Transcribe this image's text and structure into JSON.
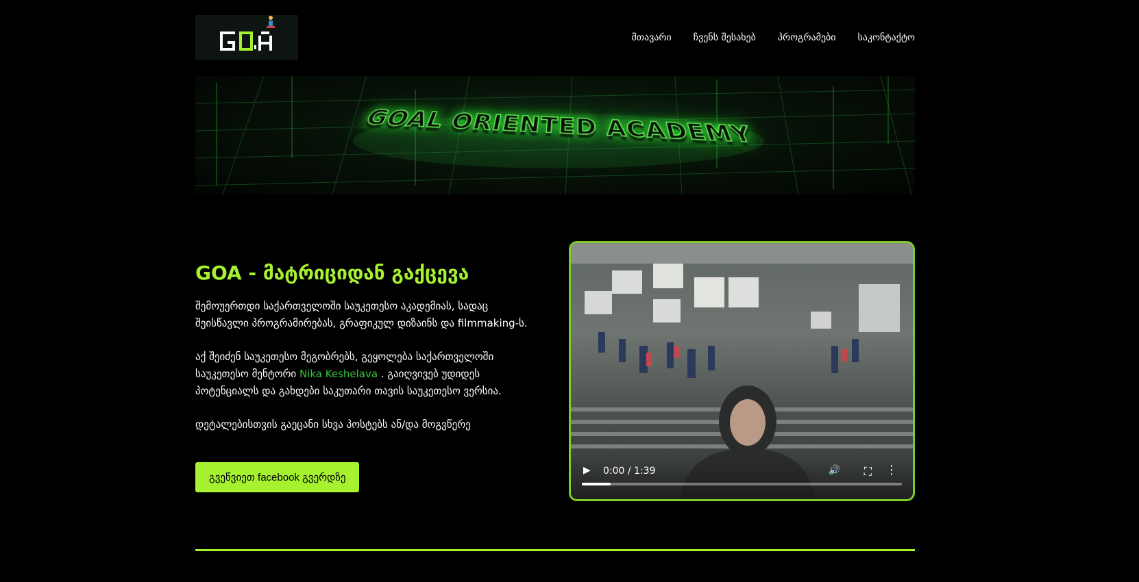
{
  "logo": {
    "text": "GOA"
  },
  "nav": {
    "items": [
      "მთავარი",
      "ჩვენს შესახებ",
      "პროგრამები",
      "საკონტაქტო"
    ]
  },
  "banner": {
    "text": "GOAL ORIENTED ACADEMY"
  },
  "hero": {
    "title": "GOA - მატრიციდან გაქცევა",
    "para1": "შემოუერთდი საქართველოში საუკეთესო აკადემიას, სადაც შეისწავლი პროგრამირებას, გრაფიკულ დიზაინს და filmmaking-ს.",
    "para2_before": "აქ შეიძენ საუკეთესო მეგობრებს, გეყოლება საქართველოში საუკეთესო მენტორი ",
    "mentor_link": "Nika Keshelava",
    "para2_after": " . გაიღვივებ უდიდეს პოტენციალს და გახდები საკუთარი თავის საუკეთესო ვერსია.",
    "para3": "დეტალებისთვის გაეცანი სხვა პოსტებს ან/და მოგვწერე",
    "cta_label": "გვეწვიეთ facebook გვერდზე"
  },
  "video": {
    "time": "0:00 / 1:39",
    "progress": 0.09,
    "icons": [
      "play-icon",
      "volume-icon",
      "fullscreen-icon",
      "more-icon"
    ]
  },
  "colors": {
    "accent": "#a6f22f",
    "link": "#37c53a",
    "border": "#7dcc28"
  }
}
